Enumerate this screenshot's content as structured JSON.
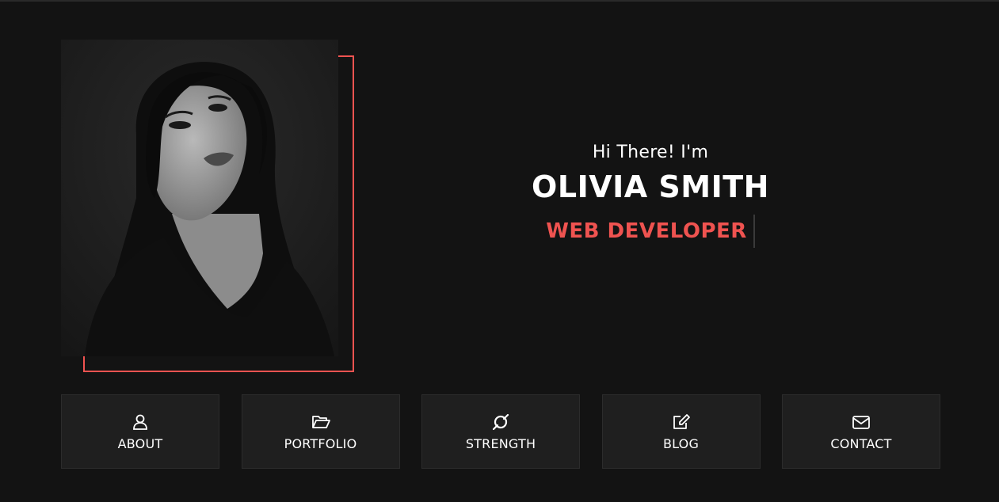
{
  "hero": {
    "greeting": "Hi There! I'm",
    "name": "OLIVIA SMITH",
    "role": "WEB DEVELOPER"
  },
  "accent_color": "#ef5350",
  "nav": [
    {
      "label": "ABOUT",
      "icon": "user-icon"
    },
    {
      "label": "PORTFOLIO",
      "icon": "folder-open-icon"
    },
    {
      "label": "STRENGTH",
      "icon": "strength-icon"
    },
    {
      "label": "BLOG",
      "icon": "edit-icon"
    },
    {
      "label": "CONTACT",
      "icon": "envelope-icon"
    }
  ]
}
